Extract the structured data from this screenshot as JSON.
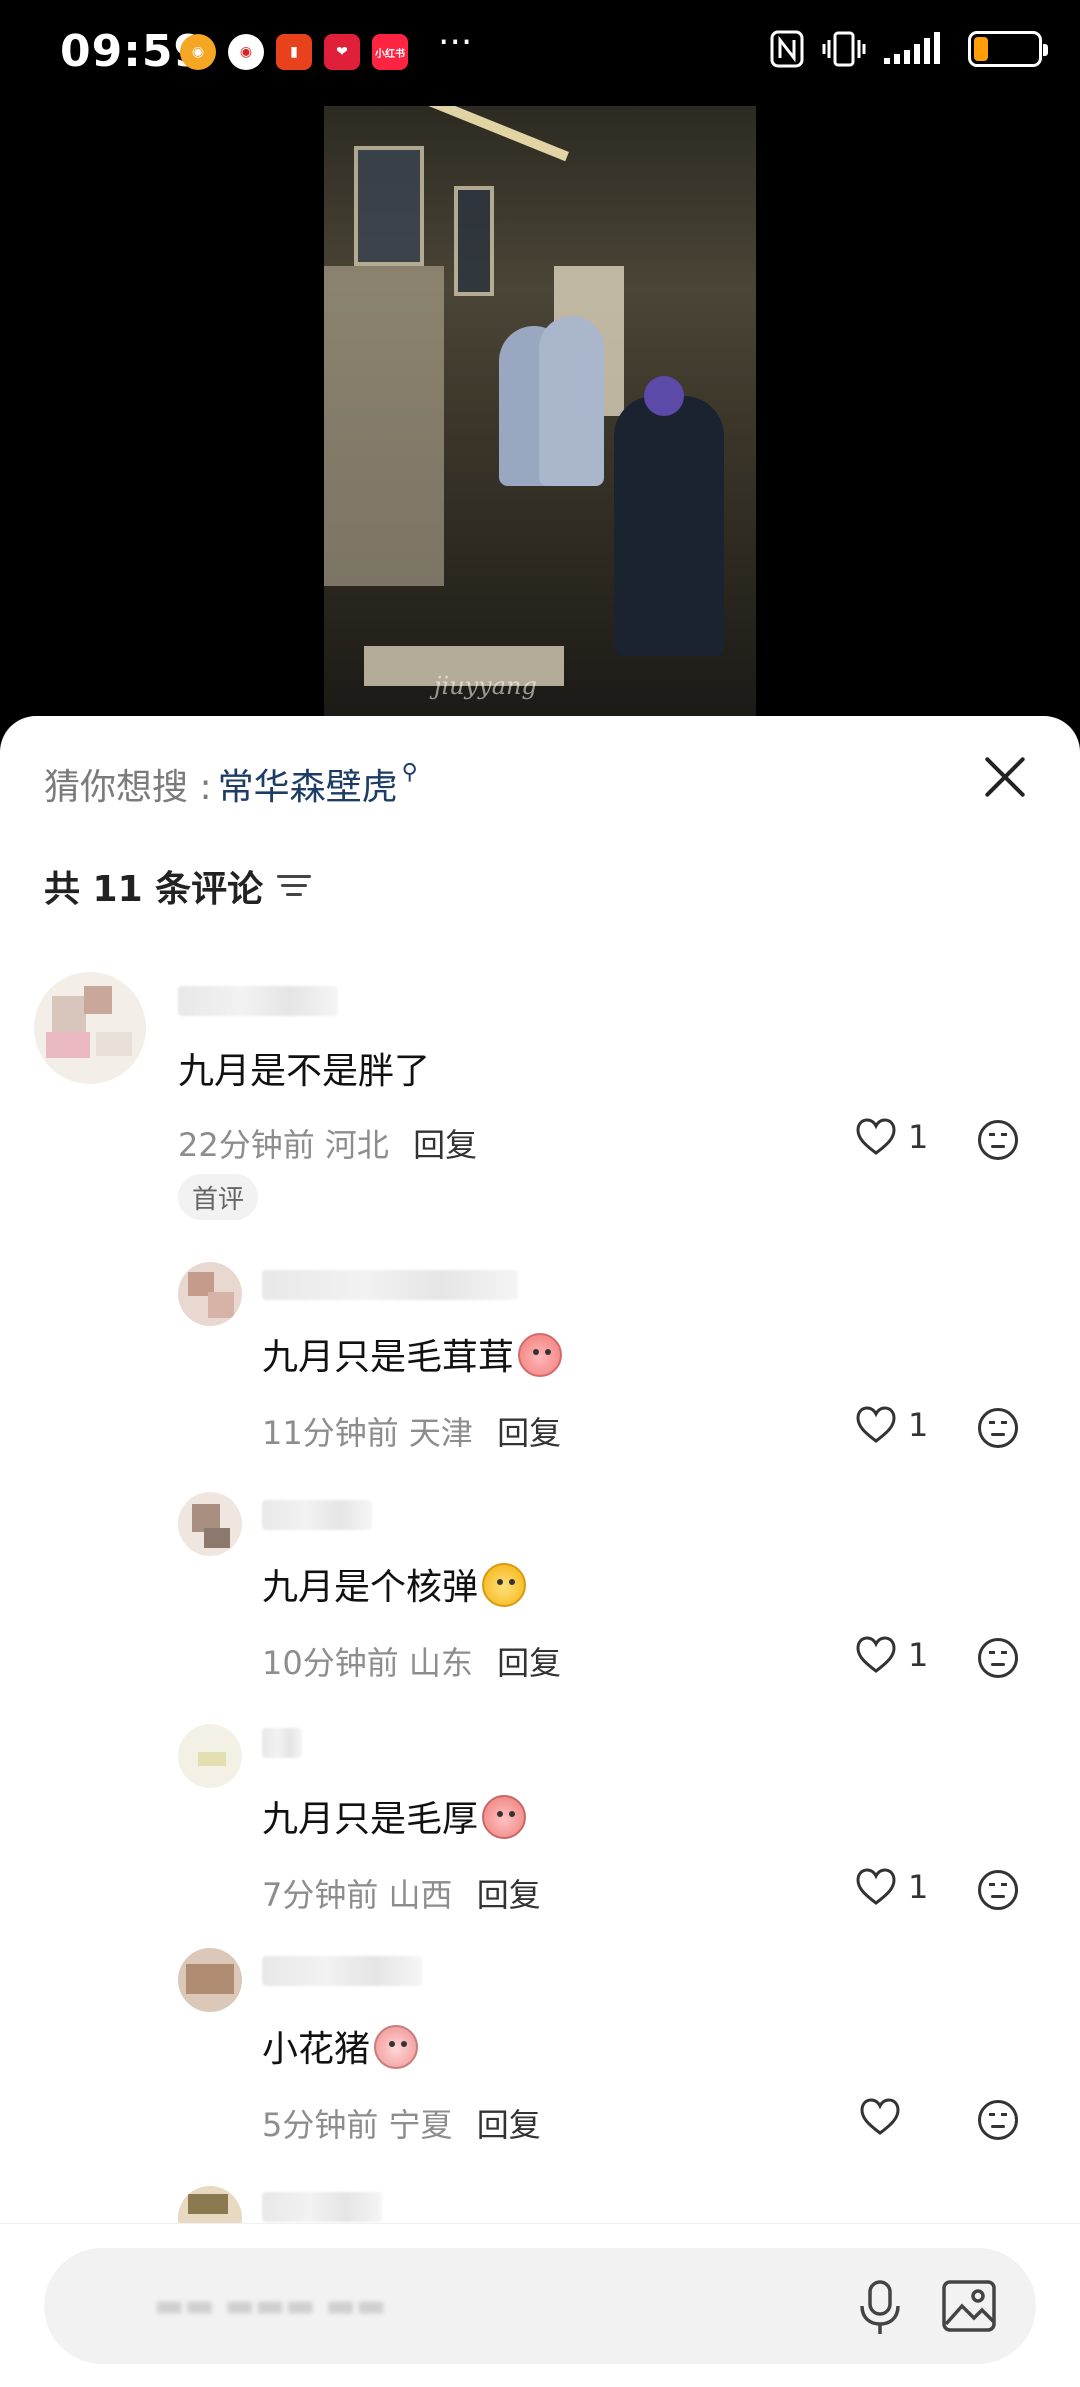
{
  "status_bar": {
    "time": "09:59",
    "more": "···",
    "icons": [
      "weibo-icon",
      "weibo-red-icon",
      "app-icon",
      "app-pink-icon",
      "xiaohongshu-icon",
      "nfc-icon",
      "vibrate-icon",
      "signal-icon",
      "battery-icon"
    ],
    "app_labels": [
      "",
      "",
      "",
      "",
      "小红书"
    ],
    "battery_level": 0.2
  },
  "video": {
    "watermark": "jiuyyang"
  },
  "search_suggestion": {
    "label": "猜你想搜 : ",
    "term": "常华森壁虎"
  },
  "comments_header": {
    "count_label": "共 11 条评论"
  },
  "comments": [
    {
      "text": "九月是不是胖了",
      "time": "22分钟前",
      "location": "河北",
      "reply": "回复",
      "likes": "1",
      "badge": "首评"
    },
    {
      "text": "九月只是毛茸茸",
      "time": "11分钟前",
      "location": "天津",
      "reply": "回复",
      "likes": "1"
    },
    {
      "text": "九月是个核弹",
      "time": "10分钟前",
      "location": "山东",
      "reply": "回复",
      "likes": "1"
    },
    {
      "text": "九月只是毛厚",
      "time": "7分钟前",
      "location": "山西",
      "reply": "回复",
      "likes": "1"
    },
    {
      "text": "小花猪",
      "time": "5分钟前",
      "location": "宁夏",
      "reply": "回复",
      "likes": ""
    }
  ],
  "colors": {
    "accent_link": "#1d3d66",
    "battery": "#ff9d0a"
  }
}
